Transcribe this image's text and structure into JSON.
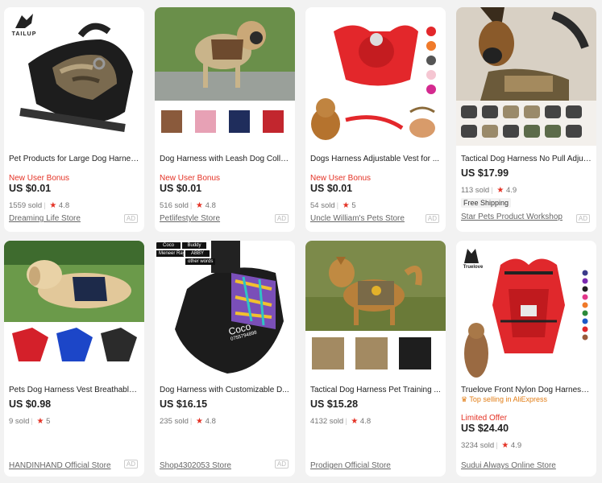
{
  "products": [
    {
      "title": "Pet Products for Large Dog Harnes...",
      "bonus": "New User Bonus",
      "price": "US $0.01",
      "sold": "1559 sold",
      "rating": "4.8",
      "store": "Dreaming Life Store",
      "ad": "AD",
      "brand": "TAILUP"
    },
    {
      "title": "Dog Harness with Leash Dog Colla...",
      "bonus": "New User Bonus",
      "price": "US $0.01",
      "sold": "516 sold",
      "rating": "4.8",
      "store": "Petlifestyle Store",
      "ad": "AD"
    },
    {
      "title": "Dogs Harness Adjustable Vest for ...",
      "bonus": "New User Bonus",
      "price": "US $0.01",
      "sold": "54 sold",
      "rating": "5",
      "store": "Uncle William's Pets Store",
      "ad": "AD"
    },
    {
      "title": "Tactical Dog Harness No Pull Adjus...",
      "price": "US $17.99",
      "sold": "113 sold",
      "rating": "4.9",
      "shipping": "Free Shipping",
      "store": "Star Pets Product Workshop",
      "ad": "AD"
    },
    {
      "title": "Pets Dog Harness Vest Breathable ...",
      "price": "US $0.98",
      "sold": "9 sold",
      "rating": "5",
      "store": "HANDINHAND Official Store",
      "ad": "AD"
    },
    {
      "title": "Dog Harness with Customizable D...",
      "price": "US $16.15",
      "sold": "235 sold",
      "rating": "4.8",
      "store": "Shop4302053 Store",
      "ad": "AD",
      "tags": [
        "Coco",
        "Buddy",
        "Meneer Ray",
        "ABBY",
        "other words"
      ],
      "badge_name": "Coco",
      "badge_phone": "0755794898"
    },
    {
      "title": "Tactical Dog Harness Pet Training ...",
      "price": "US $15.28",
      "sold": "4132 sold",
      "rating": "4.8",
      "store": "Prodigen Official Store"
    },
    {
      "title": "Truelove Front Nylon Dog Harness...",
      "top": "Top selling in AliExpress",
      "limited": "Limited Offer",
      "price": "US $24.40",
      "sold": "3234 sold",
      "rating": "4.9",
      "store": "Sudui Always Online Store",
      "brand": "Truelove"
    }
  ],
  "star_glyph": "★",
  "crown_glyph": "♛",
  "colors": {
    "red": "#e43225",
    "orange": "#e27d15",
    "background": "#f2f2f2"
  }
}
